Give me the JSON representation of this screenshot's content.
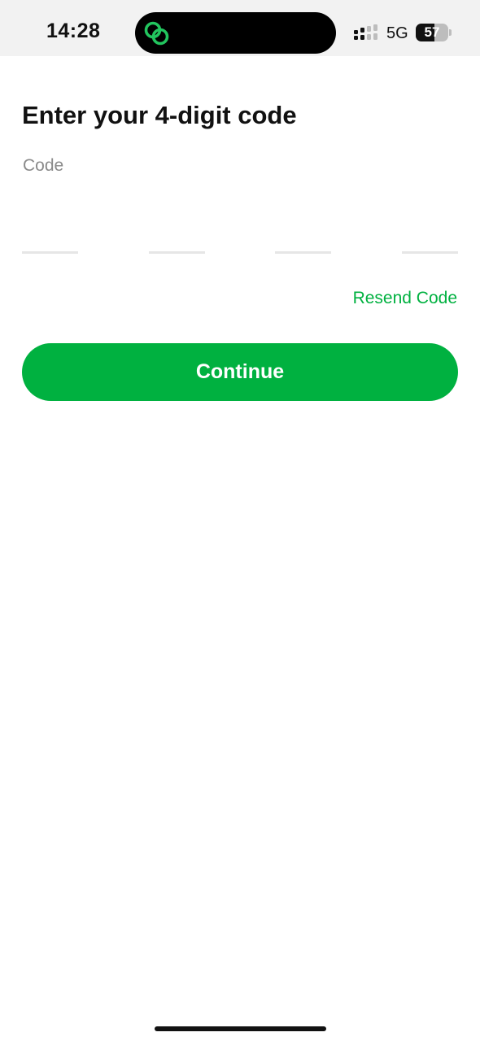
{
  "status_bar": {
    "time": "14:28",
    "network": "5G",
    "battery_level": "57",
    "battery_fraction": 0.57,
    "icons": [
      "link-icon",
      "signal-icon",
      "battery-icon"
    ],
    "accent_color": "#22c55e"
  },
  "screen": {
    "title": "Enter your 4-digit code",
    "code_label": "Code",
    "code_digits": [
      "",
      "",
      "",
      ""
    ],
    "resend_label": "Resend Code",
    "continue_label": "Continue"
  },
  "colors": {
    "brand": "#00b140",
    "label_gray": "#8a8a8a",
    "underline": "#e6e6e6"
  }
}
